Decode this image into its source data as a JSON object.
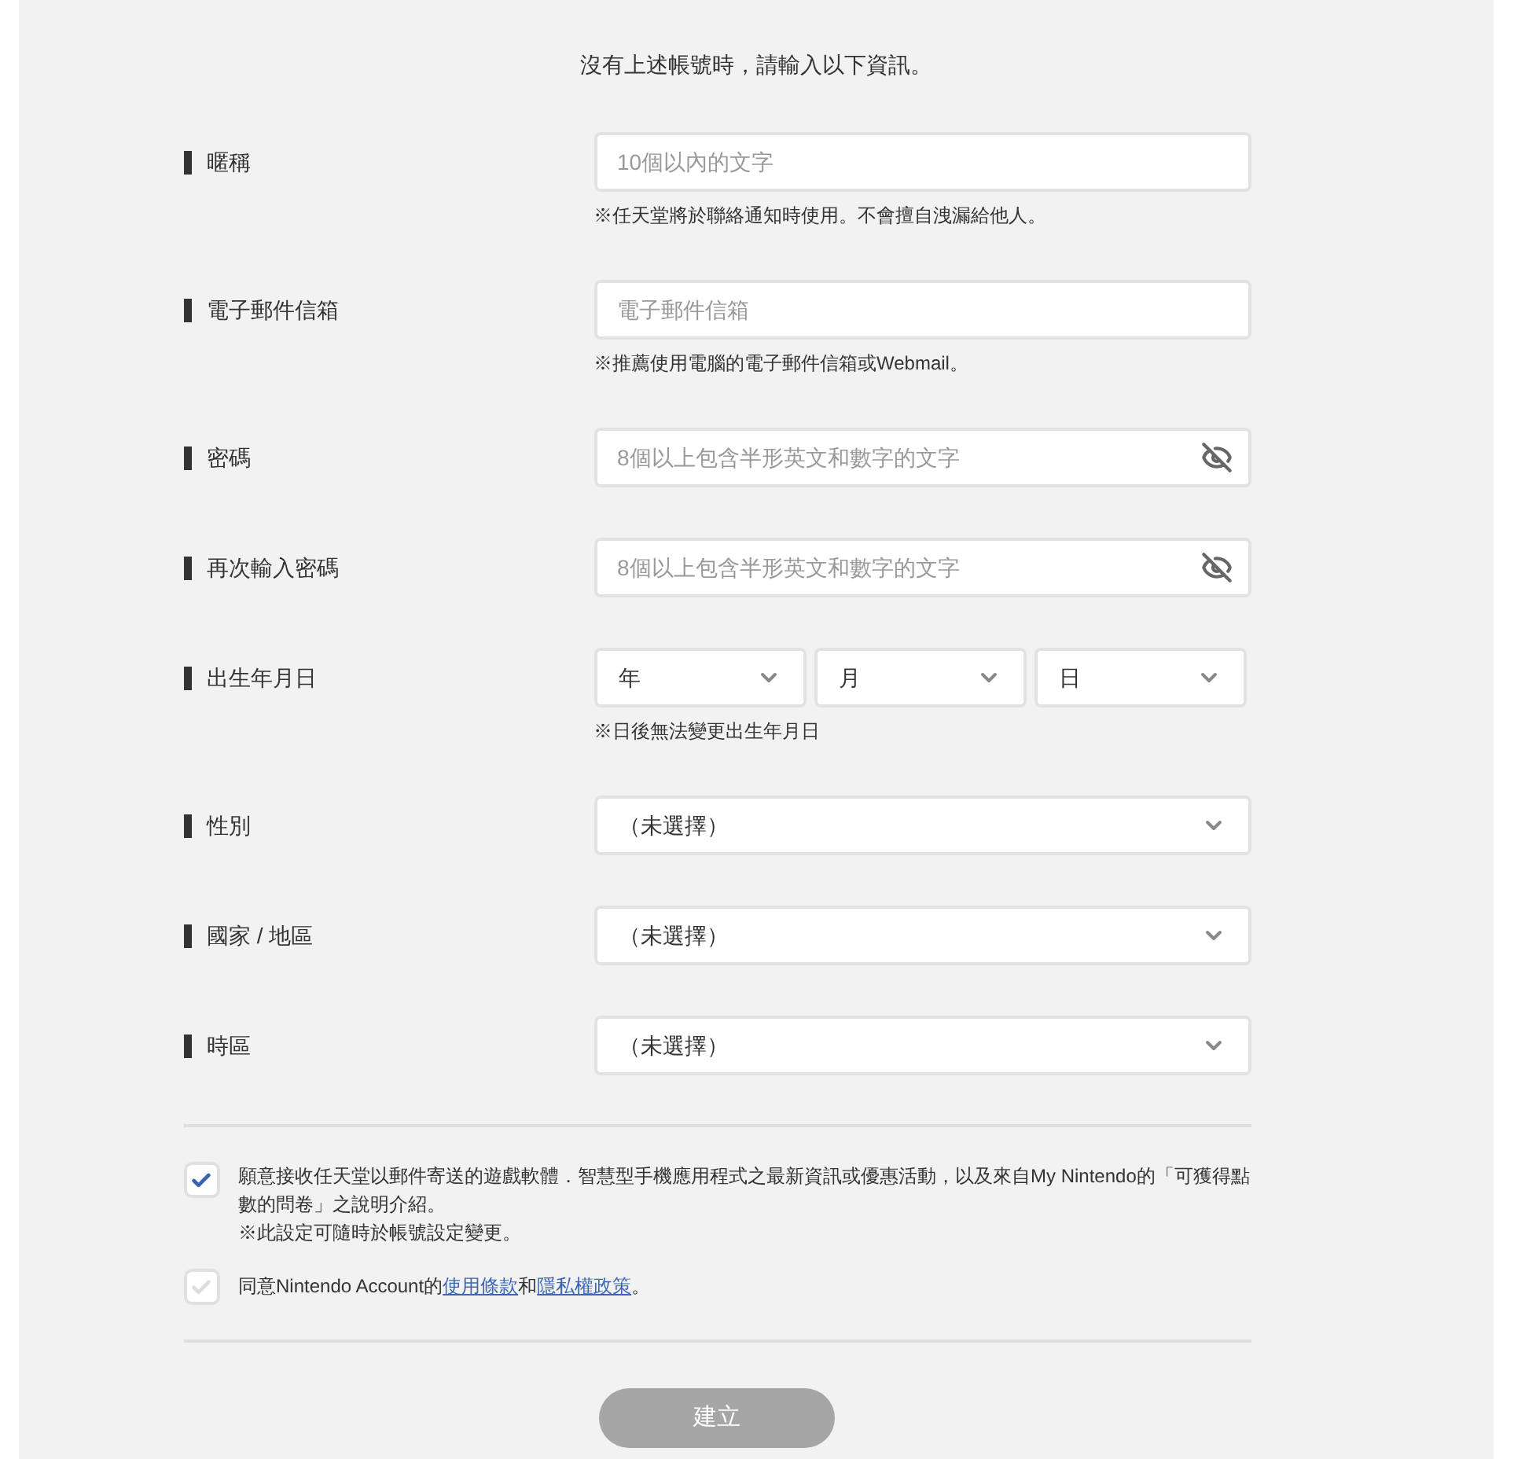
{
  "intro": "沒有上述帳號時，請輸入以下資訊。",
  "fields": [
    {
      "kind": "text",
      "label": "暱稱",
      "placeholder": "10個以內的文字",
      "note": "※任天堂將於聯絡通知時使用。不會擅自洩漏給他人。"
    },
    {
      "kind": "text",
      "label": "電子郵件信箱",
      "placeholder": "電子郵件信箱",
      "note": "※推薦使用電腦的電子郵件信箱或Webmail。"
    },
    {
      "kind": "password",
      "label": "密碼",
      "placeholder": "8個以上包含半形英文和數字的文字"
    },
    {
      "kind": "password",
      "label": "再次輸入密碼",
      "placeholder": "8個以上包含半形英文和數字的文字"
    },
    {
      "kind": "date",
      "label": "出生年月日",
      "parts": [
        "年",
        "月",
        "日"
      ],
      "note": "※日後無法變更出生年月日"
    },
    {
      "kind": "select",
      "label": "性別",
      "value": "（未選擇）"
    },
    {
      "kind": "select",
      "label": "國家 / 地區",
      "value": "（未選擇）"
    },
    {
      "kind": "select",
      "label": "時區",
      "value": "（未選擇）"
    }
  ],
  "consents": [
    {
      "checked": true,
      "lines": [
        "願意接收任天堂以郵件寄送的遊戲軟體．智慧型手機應用程式之最新資訊或優惠活動，以及來自My Nintendo的「可獲得點數的問卷」之說明介紹。",
        "※此設定可隨時於帳號設定變更。"
      ]
    },
    {
      "checked": false,
      "parts": [
        {
          "kind": "text",
          "text": "同意Nintendo Account的"
        },
        {
          "kind": "link",
          "text": "使用條款"
        },
        {
          "kind": "text",
          "text": "和"
        },
        {
          "kind": "link",
          "text": "隱私權政策"
        },
        {
          "kind": "text",
          "text": "。"
        }
      ]
    }
  ],
  "submit": {
    "label": "建立",
    "disabled": true
  }
}
